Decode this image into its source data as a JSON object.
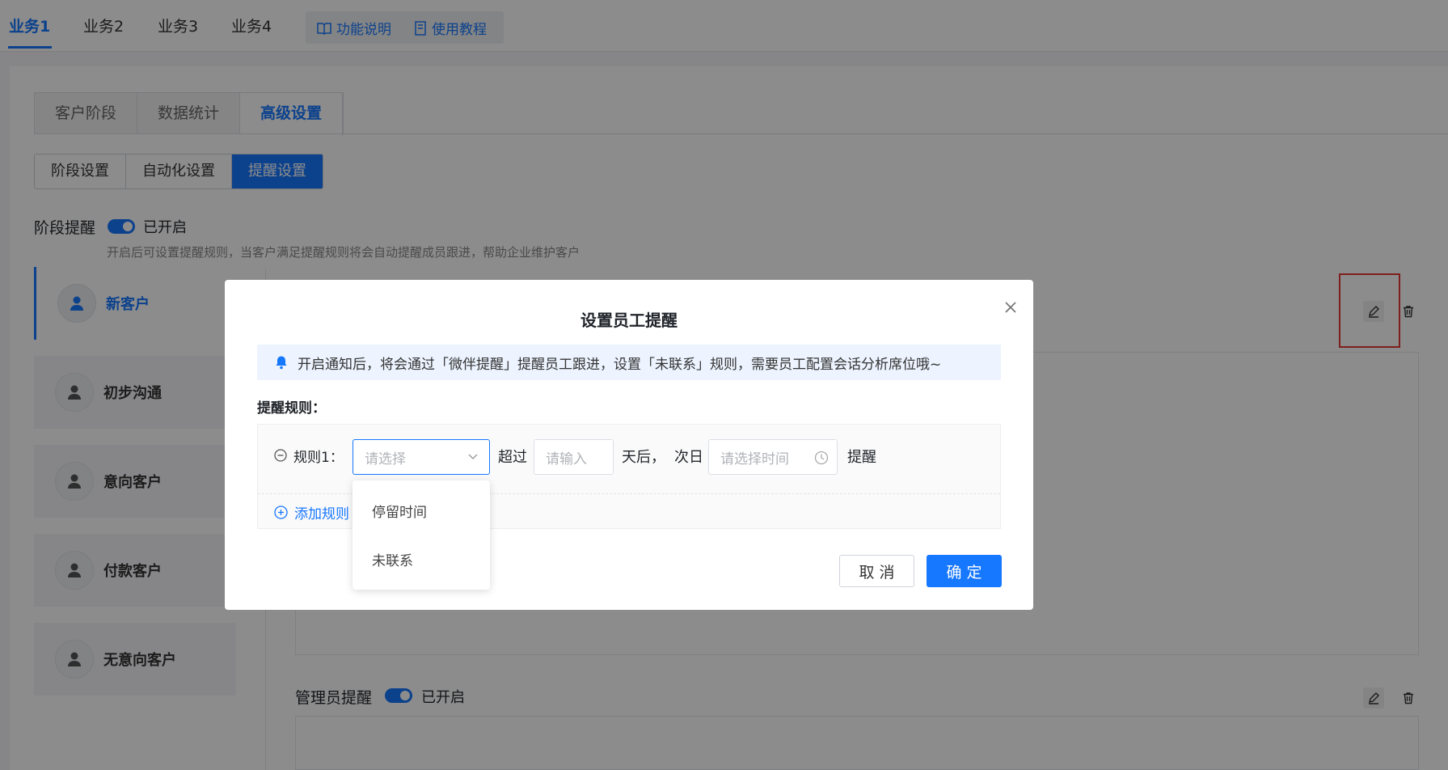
{
  "top_tabs": [
    "业务1",
    "业务2",
    "业务3",
    "业务4"
  ],
  "help_links": {
    "features": "功能说明",
    "tutorial": "使用教程"
  },
  "sub_tabs": [
    "客户阶段",
    "数据统计",
    "高级设置"
  ],
  "segments": [
    "阶段设置",
    "自动化设置",
    "提醒设置"
  ],
  "stage_reminder": {
    "title": "阶段提醒",
    "status": "已开启",
    "hint": "开启后可设置提醒规则，当客户满足提醒规则将会自动提醒成员跟进，帮助企业维护客户"
  },
  "stages": [
    "新客户",
    "初步沟通",
    "意向客户",
    "付款客户",
    "无意向客户"
  ],
  "admin_reminder": {
    "title": "管理员提醒",
    "status": "已开启"
  },
  "modal": {
    "title": "设置员工提醒",
    "notice": "开启通知后，将会通过「微伴提醒」提醒员工跟进，设置「未联系」规则，需要员工配置会话分析席位哦~",
    "rules_label": "提醒规则：",
    "rule": {
      "label": "规则1：",
      "select_placeholder": "请选择",
      "exceed": "超过",
      "input_placeholder": "请输入",
      "days_after": "天后，",
      "next_day": "次日",
      "time_placeholder": "请选择时间",
      "remind": "提醒"
    },
    "add_rule": "添加规则",
    "dropdown_options": [
      "停留时间",
      "未联系"
    ],
    "cancel": "取 消",
    "confirm": "确 定"
  },
  "colors": {
    "accent": "#1677ff",
    "highlight_border": "#e53935"
  }
}
